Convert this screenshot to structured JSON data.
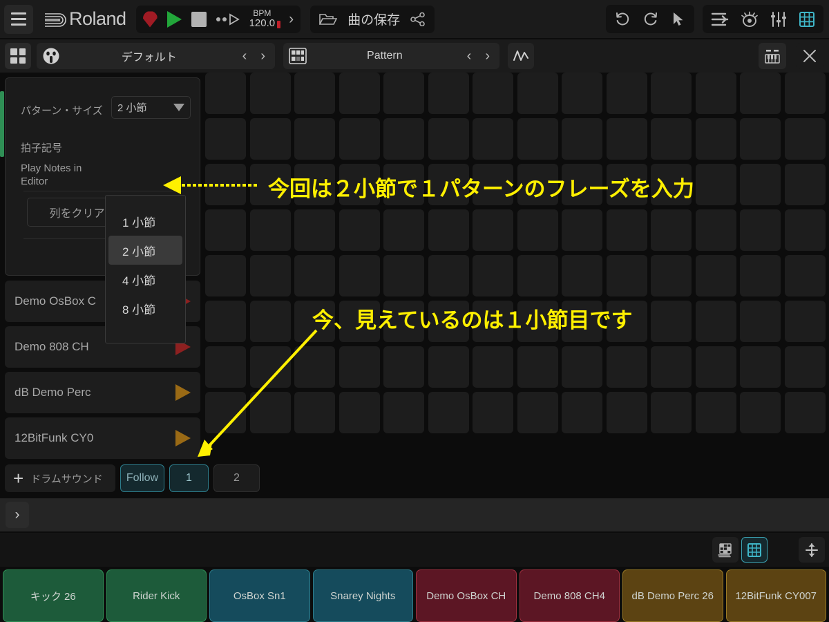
{
  "topbar": {
    "menu_icon": "hamburger-menu-icon",
    "brand": "Roland",
    "transport": {
      "record": "record-icon",
      "play": "play-icon",
      "stop": "stop-icon",
      "metronome": "metronome-icon",
      "bpm_label": "BPM",
      "bpm_value": "120.0",
      "expand": "›"
    },
    "file": {
      "open_icon": "folder-open-icon",
      "save_label": "曲の保存",
      "share_icon": "share-icon"
    },
    "right_icons_group1": [
      "undo-icon",
      "redo-icon",
      "pointer-icon"
    ],
    "right_icons_group2": [
      "align-icon",
      "eye-icon",
      "mixer-icon",
      "grid-icon"
    ]
  },
  "subbar": {
    "grid_button": "four-squares-icon",
    "kit": {
      "icon": "kit-face-icon",
      "name": "デフォルト",
      "prev": "‹",
      "next": "›"
    },
    "pattern": {
      "icon": "pattern-icon",
      "name": "Pattern",
      "prev": "‹",
      "next": "›"
    },
    "automation_icon": "automation-curve-icon",
    "keyboard_icon": "keyboard-icon",
    "close_icon": "close-icon"
  },
  "settings_panel": {
    "pattern_size_label": "パターン・サイズ",
    "pattern_size_value": "2 小節",
    "time_signature_label": "拍子記号",
    "play_notes_label": "Play Notes in Editor",
    "clear_column_label": "列をクリア",
    "dropdown_options": [
      "1 小節",
      "2 小節",
      "4 小節",
      "8 小節"
    ],
    "dropdown_selected": "2 小節"
  },
  "tracks": [
    {
      "name": "Demo OsBox C",
      "color": "#8d2020"
    },
    {
      "name": "Demo 808 CH",
      "color": "#8d2020"
    },
    {
      "name": "dB Demo Perc",
      "color": "#9a6a15"
    },
    {
      "name": "12BitFunk CY0",
      "color": "#9a6a15"
    }
  ],
  "grid": {
    "rows": 8,
    "cols": 14
  },
  "bottom_controls": {
    "add_sound_label": "ドラムサウンド",
    "add_icon": "plus-icon",
    "follow_label": "Follow",
    "bar_buttons": [
      "1",
      "2"
    ],
    "active_bar": "1"
  },
  "strip": {
    "expand_icon": "chevron-right-icon"
  },
  "bottom_toolbar": {
    "icons": [
      "layered-grid-icon",
      "grid-view-icon",
      "resize-vertical-icon"
    ],
    "active_icon": "grid-view-icon"
  },
  "pads": [
    {
      "label": "キック 26",
      "bg": "#1d5b3a",
      "border": "#2f8f55"
    },
    {
      "label": "Rider Kick",
      "bg": "#1d5b3a",
      "border": "#2f8f55"
    },
    {
      "label": "OsBox Sn1",
      "bg": "#154b5c",
      "border": "#2d7d8c"
    },
    {
      "label": "Snarey Nights",
      "bg": "#154b5c",
      "border": "#2d7d8c"
    },
    {
      "label": "Demo OsBox CH",
      "bg": "#5c1624",
      "border": "#a0303f"
    },
    {
      "label": "Demo 808 CH4",
      "bg": "#5c1624",
      "border": "#a0303f"
    },
    {
      "label": "dB Demo Perc 26",
      "bg": "#5c4312",
      "border": "#9a7a25"
    },
    {
      "label": "12BitFunk CY007",
      "bg": "#5c4312",
      "border": "#9a7a25"
    }
  ],
  "annotations": {
    "accent_color": "#fff000",
    "note1": "今回は２小節で１パターンのフレーズを入力",
    "note2": "今、見えているのは１小節目です"
  }
}
